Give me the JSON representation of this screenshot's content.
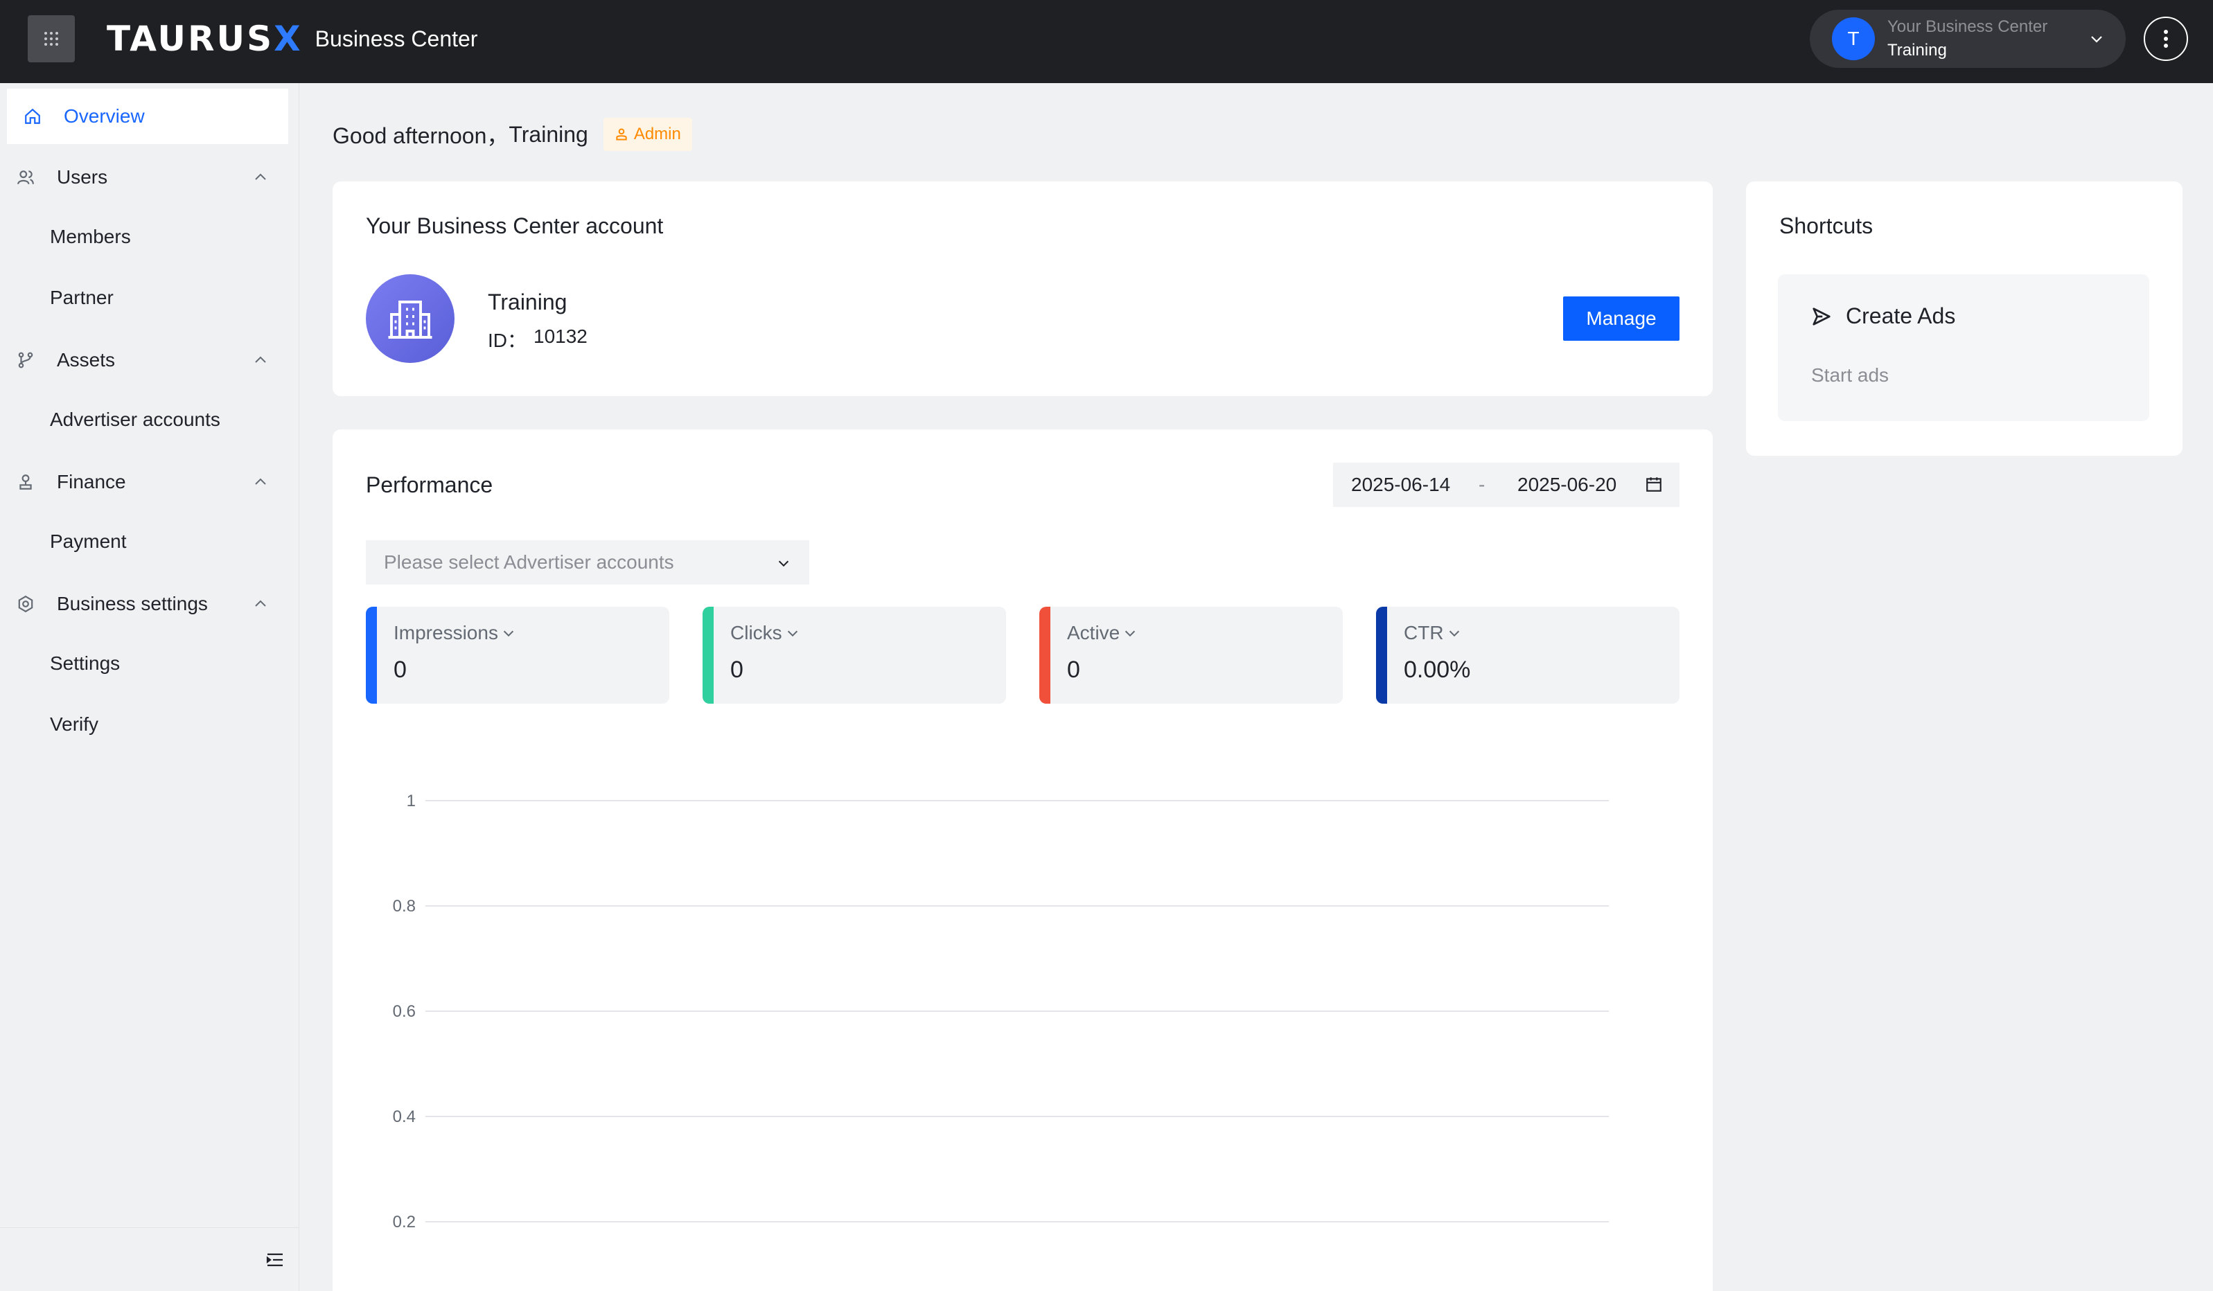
{
  "header": {
    "logo_main": "TAURUS",
    "logo_x": "X",
    "logo_sub": "Business Center",
    "account_label": "Your Business Center",
    "account_name": "Training",
    "avatar_letter": "T"
  },
  "sidebar": {
    "overview": "Overview",
    "users": "Users",
    "members": "Members",
    "partner": "Partner",
    "assets": "Assets",
    "advertiser_accounts": "Advertiser accounts",
    "finance": "Finance",
    "payment": "Payment",
    "business_settings": "Business settings",
    "settings": "Settings",
    "verify": "Verify"
  },
  "greeting": {
    "text": "Good afternoon，",
    "name": "Training",
    "role": "Admin"
  },
  "bc_account": {
    "title": "Your Business Center account",
    "name": "Training",
    "id_label": "ID：",
    "id_value": "10132",
    "manage_label": "Manage"
  },
  "shortcuts": {
    "title": "Shortcuts",
    "create_ads": "Create Ads",
    "start_ads": "Start ads"
  },
  "performance": {
    "title": "Performance",
    "date_start": "2025-06-14",
    "date_sep": "-",
    "date_end": "2025-06-20",
    "advertiser_placeholder": "Please select Advertiser accounts",
    "metrics": [
      {
        "label": "Impressions",
        "value": "0",
        "color": "#1966ff"
      },
      {
        "label": "Clicks",
        "value": "0",
        "color": "#2fcf9e"
      },
      {
        "label": "Active",
        "value": "0",
        "color": "#f0503a"
      },
      {
        "label": "CTR",
        "value": "0.00%",
        "color": "#0a3aa8"
      }
    ]
  },
  "chart_data": {
    "type": "line",
    "ytick_labels": [
      "1",
      "0.8",
      "0.6",
      "0.4",
      "0.2"
    ],
    "ylim": [
      0,
      1
    ],
    "grid": true,
    "series": []
  }
}
